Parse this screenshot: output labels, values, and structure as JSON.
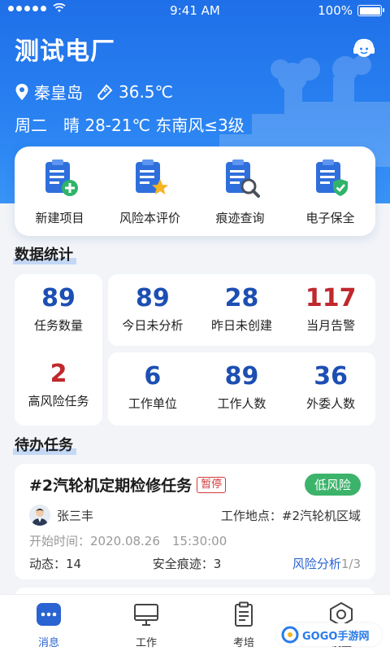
{
  "status_bar": {
    "time": "9:41 AM",
    "battery": "100%"
  },
  "header": {
    "title": "测试电厂",
    "location": "秦皇岛",
    "temperature": "36.5℃",
    "forecast": "周二　晴 28-21℃ 东南风≤3级",
    "icons": {
      "location": "location-pin-icon",
      "temperature": "thermometer-icon",
      "service": "customer-service-icon"
    }
  },
  "quick_actions": [
    {
      "label": "新建项目",
      "icon": "clipboard-plus-icon"
    },
    {
      "label": "风险本评价",
      "icon": "clipboard-star-icon"
    },
    {
      "label": "痕迹查询",
      "icon": "clipboard-search-icon"
    },
    {
      "label": "电子保全",
      "icon": "clipboard-shield-icon"
    }
  ],
  "stats": {
    "title": "数据统计",
    "left": [
      {
        "value": "89",
        "label": "任务数量"
      },
      {
        "value": "2",
        "label": "高风险任务"
      }
    ],
    "top": [
      {
        "value": "89",
        "label": "今日未分析"
      },
      {
        "value": "28",
        "label": "昨日未创建"
      },
      {
        "value": "117",
        "label": "当月告警"
      }
    ],
    "bottom": [
      {
        "value": "6",
        "label": "工作单位"
      },
      {
        "value": "89",
        "label": "工作人数"
      },
      {
        "value": "36",
        "label": "外委人数"
      }
    ]
  },
  "todo": {
    "title": "待办任务",
    "task": {
      "name": "#2汽轮机定期检修任务",
      "status": "暂停",
      "risk": "低风险",
      "owner": "张三丰",
      "location": "工作地点：#2汽轮机区域",
      "start_time": "开始时间：2020.08.26　15:30:00",
      "dynamic_label": "动态：",
      "dynamic_value": "14",
      "trace_label": "安全痕迹：",
      "trace_value": "3",
      "analysis_label": "风险分析",
      "analysis_progress": "1/3"
    }
  },
  "tabbar": [
    {
      "label": "消息",
      "icon": "message-icon",
      "active": true
    },
    {
      "label": "工作",
      "icon": "monitor-icon",
      "active": false
    },
    {
      "label": "考培",
      "icon": "exam-clipboard-icon",
      "active": false
    },
    {
      "label": "设置",
      "icon": "settings-hex-icon",
      "active": false
    }
  ],
  "watermark": {
    "text": "GOGO手游网"
  },
  "colors": {
    "primary": "#2a63d2",
    "header": "#2c86f3",
    "danger": "#c0282d",
    "success": "#3cb36b"
  }
}
